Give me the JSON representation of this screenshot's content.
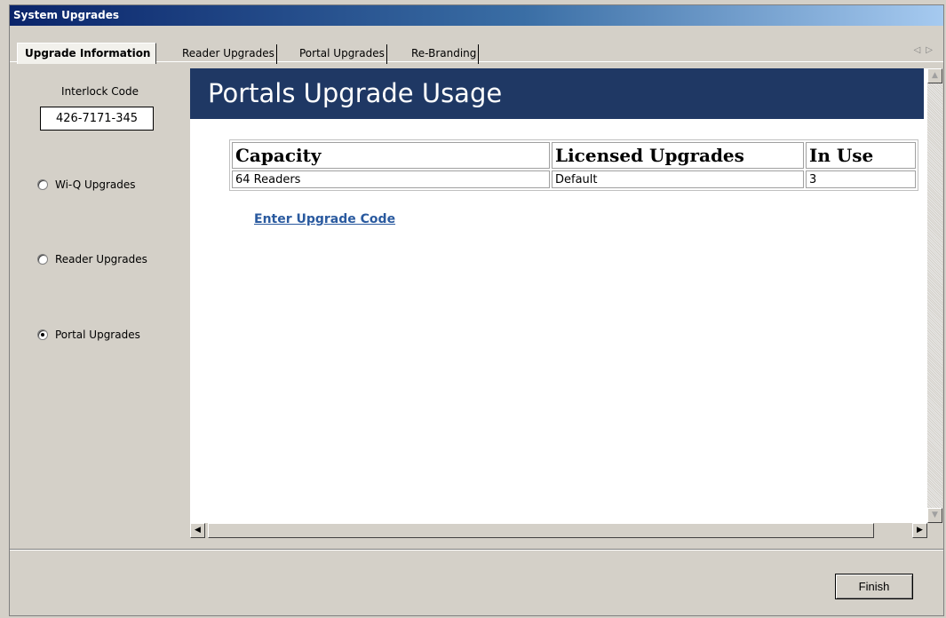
{
  "window": {
    "title": "System Upgrades"
  },
  "tabs": [
    {
      "label": "Upgrade Information",
      "active": true
    },
    {
      "label": "Reader Upgrades",
      "active": false
    },
    {
      "label": "Portal Upgrades",
      "active": false
    },
    {
      "label": "Re-Branding",
      "active": false
    }
  ],
  "tab_scroll": {
    "left_icon": "tab-scroll-left-icon",
    "right_icon": "tab-scroll-right-icon",
    "glyphs": "◁▷"
  },
  "left_panel": {
    "interlock_label": "Interlock Code",
    "interlock_value": "426-7171-345",
    "radios": [
      {
        "label": "Wi-Q Upgrades",
        "checked": false
      },
      {
        "label": "Reader Upgrades",
        "checked": false
      },
      {
        "label": "Portal Upgrades",
        "checked": true
      }
    ]
  },
  "content": {
    "heading": "Portals Upgrade Usage",
    "table": {
      "headers": [
        "Capacity",
        "Licensed Upgrades",
        "In Use"
      ],
      "rows": [
        [
          "64 Readers",
          "Default",
          "3"
        ]
      ]
    },
    "link_label": "Enter Upgrade Code"
  },
  "footer": {
    "finish_label": "Finish"
  },
  "colors": {
    "banner": "#1f3864",
    "link": "#2a5a9f",
    "title_start": "#0a246a",
    "title_end": "#a6caf0"
  }
}
